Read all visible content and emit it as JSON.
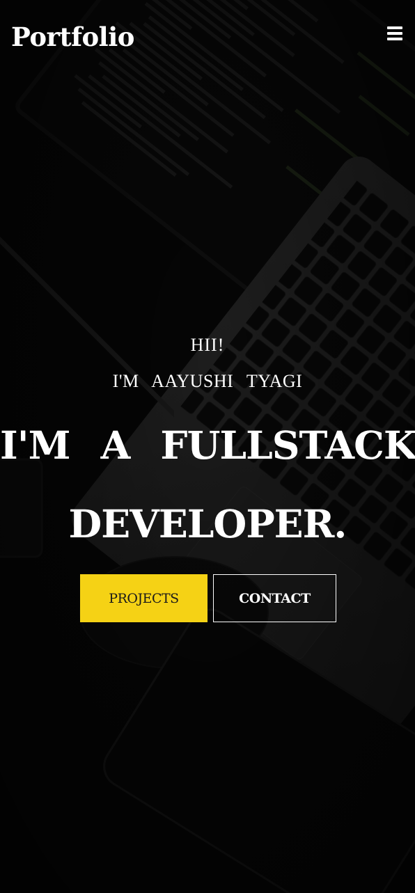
{
  "navbar": {
    "brand": "Portfolio",
    "menu_icon": "hamburger-menu-icon"
  },
  "hero": {
    "greeting_line1": "HII!",
    "greeting_line2": "I'M AAYUSHI TYAGI",
    "headline_line1": "I'M A FULLSTACK",
    "headline_line2": "DEVELOPER.",
    "buttons": {
      "projects": "PROJECTS",
      "contact": "CONTACT"
    }
  },
  "colors": {
    "background": "#090909",
    "text": "#ffffff",
    "accent": "#f5d215"
  }
}
